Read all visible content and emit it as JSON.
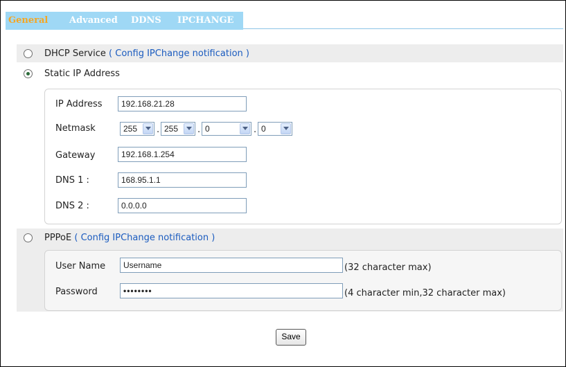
{
  "tabs": [
    {
      "label": "General",
      "active": true
    },
    {
      "label": "Advanced",
      "active": false
    },
    {
      "label": "DDNS",
      "active": false
    },
    {
      "label": "IPCHANGE",
      "active": false
    }
  ],
  "dhcp": {
    "label": "DHCP Service",
    "link": "( Config IPChange notification )",
    "selected": false
  },
  "static_ip": {
    "label": "Static IP Address",
    "selected": true,
    "ip_address": {
      "label": "IP Address",
      "value": "192.168.21.28"
    },
    "netmask": {
      "label": "Netmask",
      "octets": [
        "255",
        "255",
        "0",
        "0"
      ],
      "separator": "."
    },
    "gateway": {
      "label": "Gateway",
      "value": "192.168.1.254"
    },
    "dns1": {
      "label": "DNS 1 :",
      "value": "168.95.1.1"
    },
    "dns2": {
      "label": "DNS 2 :",
      "value": "0.0.0.0"
    }
  },
  "pppoe": {
    "label": "PPPoE",
    "link": "( Config IPChange notification )",
    "selected": false,
    "username": {
      "label": "User Name",
      "value": "Username",
      "hint": "(32 character max)"
    },
    "password": {
      "label": "Password",
      "value": "••••••••",
      "hint": "(4 character min,32 character max)"
    }
  },
  "save_label": "Save",
  "colors": {
    "tab_bar": "#9fd8f5",
    "active_tab": "#f5a623",
    "link": "#1a5bbf",
    "row_background": "#ededed"
  }
}
